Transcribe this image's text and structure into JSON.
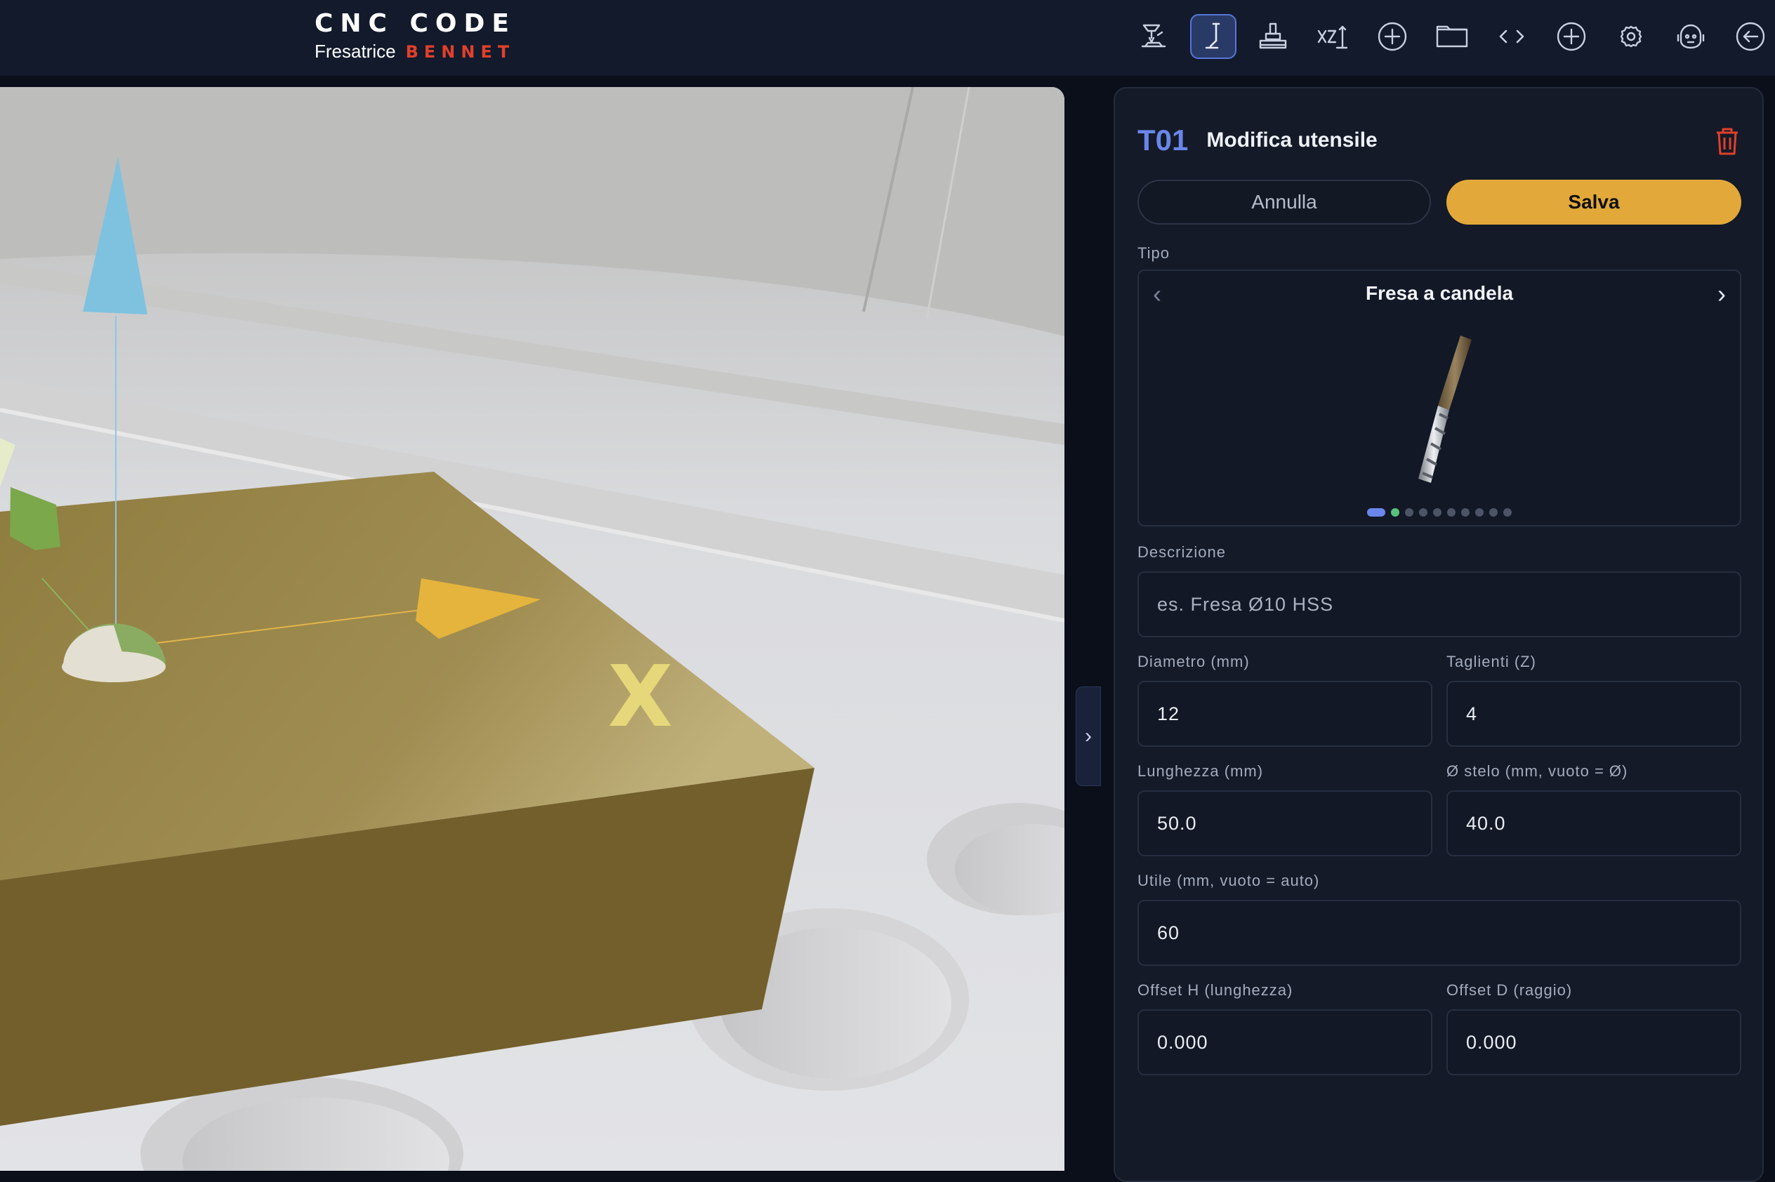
{
  "header": {
    "brand_title": "CNC CODE",
    "brand_sub": "Fresatrice",
    "brand_accent": "BENNET",
    "tools": [
      {
        "icon": "machine-icon",
        "active": false
      },
      {
        "icon": "tool-icon",
        "active": true
      },
      {
        "icon": "workpiece-icon",
        "active": false
      },
      {
        "icon": "xz-axis-icon",
        "active": false
      },
      {
        "icon": "add-circle-icon",
        "active": false
      },
      {
        "icon": "folder-icon",
        "active": false
      },
      {
        "icon": "code-icon",
        "active": false
      },
      {
        "icon": "add-circle-icon",
        "active": false
      },
      {
        "icon": "gear-icon",
        "active": false
      },
      {
        "icon": "robot-icon",
        "active": false
      },
      {
        "icon": "back-circle-icon",
        "active": false
      }
    ]
  },
  "viewport": {
    "axis_label": "X"
  },
  "panel": {
    "tool_code": "T01",
    "title": "Modifica utensile",
    "cancel_label": "Annulla",
    "save_label": "Salva",
    "type_label": "Tipo",
    "type_value": "Fresa a candela",
    "type_index": 1,
    "type_count": 10,
    "description_label": "Descrizione",
    "description_placeholder": "es. Fresa Ø10 HSS",
    "diameter_label": "Diametro (mm)",
    "diameter_value": "12",
    "teeth_label": "Taglienti (Z)",
    "teeth_value": "4",
    "length_label": "Lunghezza (mm)",
    "length_value": "50.0",
    "shank_label": "Ø stelo (mm, vuoto = Ø)",
    "shank_value": "40.0",
    "useful_label": "Utile (mm, vuoto = auto)",
    "useful_value": "60",
    "offset_h_label": "Offset H (lunghezza)",
    "offset_h_value": "0.000",
    "offset_d_label": "Offset D (raggio)",
    "offset_d_value": "0.000"
  },
  "colors": {
    "accent": "#6a86ea",
    "save": "#e2a93a",
    "delete": "#e0402b",
    "workpiece_top": "#9a8748",
    "workpiece_side": "#735f2b"
  }
}
